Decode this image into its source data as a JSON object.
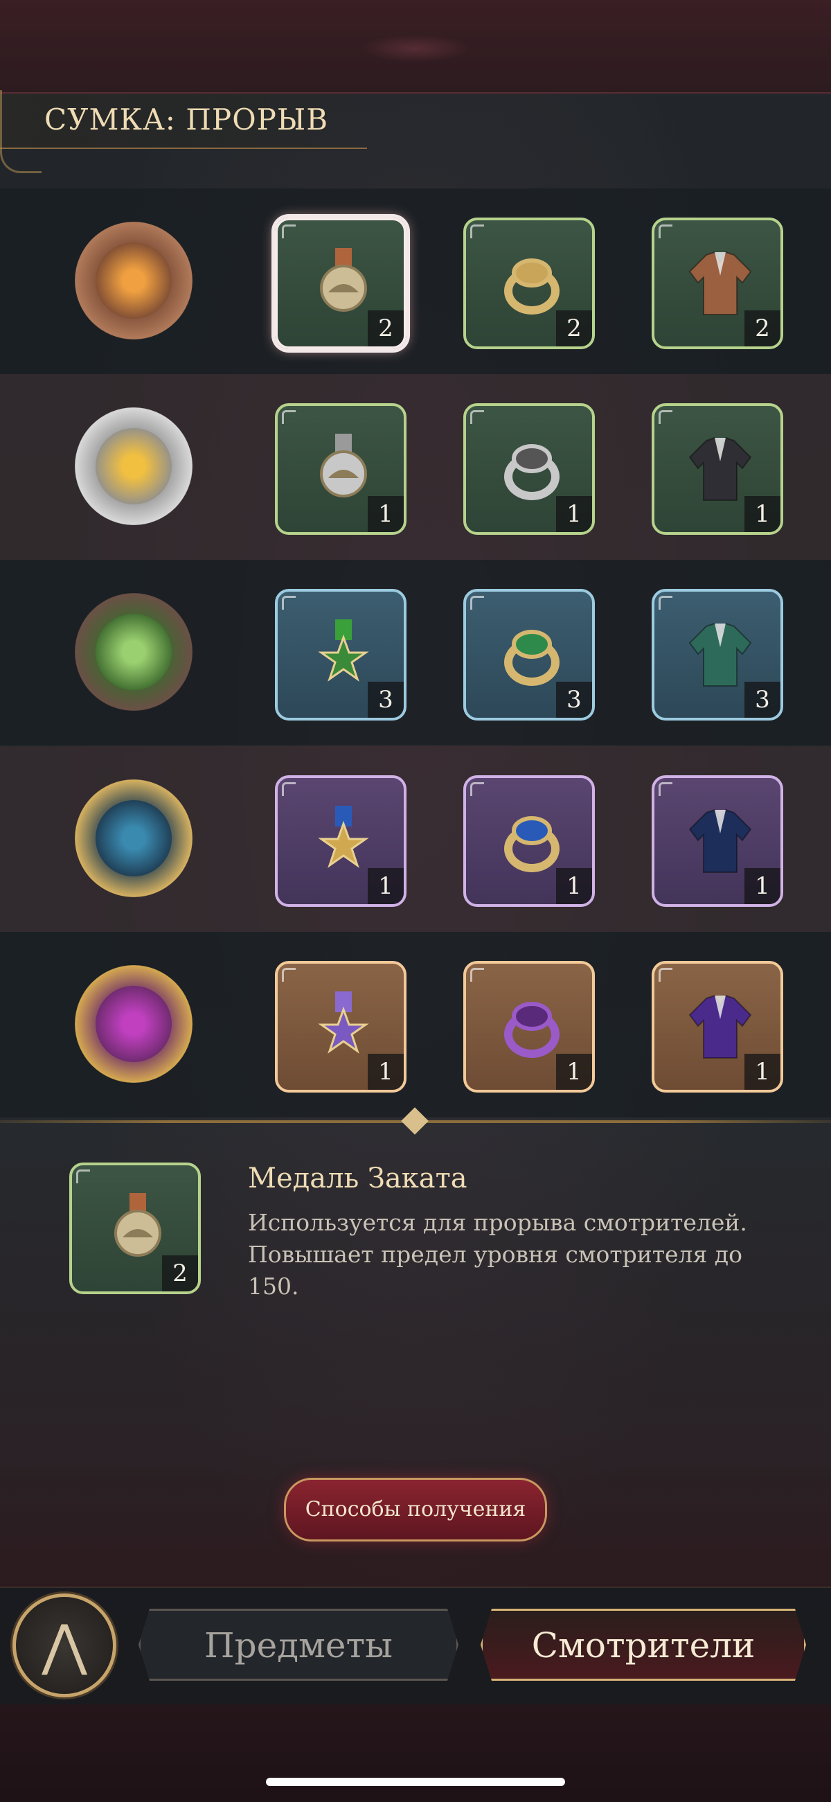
{
  "header": {
    "title": "СУМКА: ПРОРЫВ"
  },
  "rows": [
    {
      "emblem_icon": "sunset-emblem-icon",
      "items": [
        {
          "icon": "sunset-medal-icon",
          "count": "2",
          "rarity": "green",
          "selected": true
        },
        {
          "icon": "sunset-ring-icon",
          "count": "2",
          "rarity": "green"
        },
        {
          "icon": "brown-jacket-icon",
          "count": "2",
          "rarity": "green"
        }
      ]
    },
    {
      "emblem_icon": "eye-emblem-icon",
      "items": [
        {
          "icon": "silver-eye-medal-icon",
          "count": "1",
          "rarity": "green"
        },
        {
          "icon": "silver-eye-ring-icon",
          "count": "1",
          "rarity": "green"
        },
        {
          "icon": "black-jacket-icon",
          "count": "1",
          "rarity": "green"
        }
      ]
    },
    {
      "emblem_icon": "green-knot-emblem-icon",
      "items": [
        {
          "icon": "green-star-medal-icon",
          "count": "3",
          "rarity": "blue"
        },
        {
          "icon": "gold-green-ring-icon",
          "count": "3",
          "rarity": "blue"
        },
        {
          "icon": "green-jacket-icon",
          "count": "3",
          "rarity": "blue"
        }
      ]
    },
    {
      "emblem_icon": "blue-star-emblem-icon",
      "items": [
        {
          "icon": "blue-star-medal-icon",
          "count": "1",
          "rarity": "purple"
        },
        {
          "icon": "gold-blue-ring-icon",
          "count": "1",
          "rarity": "purple"
        },
        {
          "icon": "navy-jacket-icon",
          "count": "1",
          "rarity": "purple"
        }
      ]
    },
    {
      "emblem_icon": "purple-gem-emblem-icon",
      "items": [
        {
          "icon": "purple-star-medal-icon",
          "count": "1",
          "rarity": "orange"
        },
        {
          "icon": "purple-gem-ring-icon",
          "count": "1",
          "rarity": "orange"
        },
        {
          "icon": "purple-tuxedo-icon",
          "count": "1",
          "rarity": "orange"
        }
      ]
    }
  ],
  "detail": {
    "icon": "sunset-medal-icon",
    "count": "2",
    "name": "Медаль Заката",
    "description": "Используется для прорыва смотрителей. Повышает предел уровня смотрителя до 150."
  },
  "obtain_button": "Способы получения",
  "tabs": {
    "items": "Предметы",
    "keepers": "Смотрители",
    "active": "keepers"
  },
  "colors": {
    "green_border": "#b6d28c",
    "blue_border": "#9ccbe0",
    "purple_border": "#d0b2e6",
    "orange_border": "#f2c998",
    "accent_gold": "#d7b476",
    "button_red": "#8a2430"
  }
}
